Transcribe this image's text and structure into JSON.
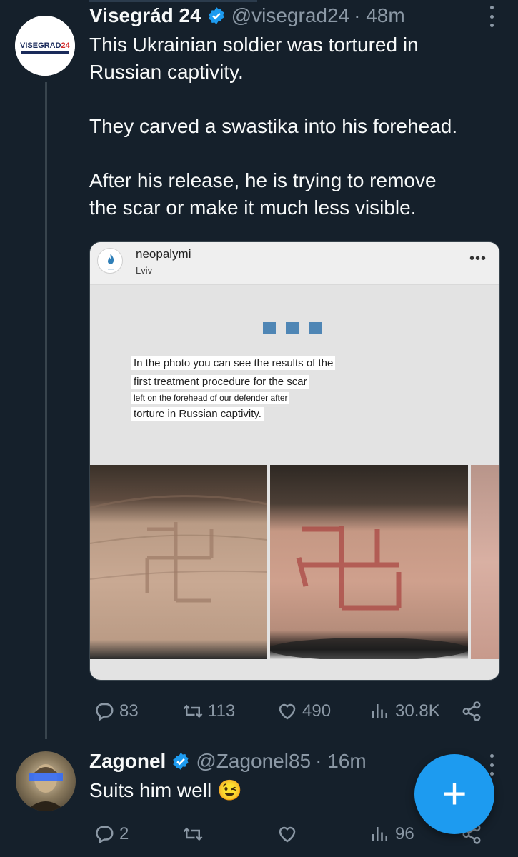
{
  "tweet1": {
    "avatar_label": "VISEGRAD24",
    "name": "Visegrád 24",
    "handle": "@visegrad24",
    "time": "· 48m",
    "text": "This Ukrainian soldier was tortured in\nRussian captivity.\n\nThey carved a swastika into his forehead.\n\nAfter his release, he is trying to remove\nthe scar or make it much less visible.",
    "media": {
      "user": "neopalymi",
      "location": "Lviv",
      "caption_lines": [
        "In the photo you can see the results of the",
        "first treatment procedure for the scar",
        "left on the forehead of our defender after",
        "torture in Russian captivity."
      ]
    },
    "stats": {
      "replies": "83",
      "retweets": "113",
      "likes": "490",
      "views": "30.8K"
    }
  },
  "tweet2": {
    "name": "Zagonel",
    "handle": "@Zagonel85",
    "time": "· 16m",
    "text": "Suits him well 😉",
    "stats": {
      "replies": "2",
      "retweets": "",
      "likes": "",
      "views": "96"
    }
  },
  "fab": {
    "label": "+"
  },
  "colors": {
    "background": "#15202b",
    "accent": "#1d9bf0",
    "muted": "#8b98a5"
  }
}
